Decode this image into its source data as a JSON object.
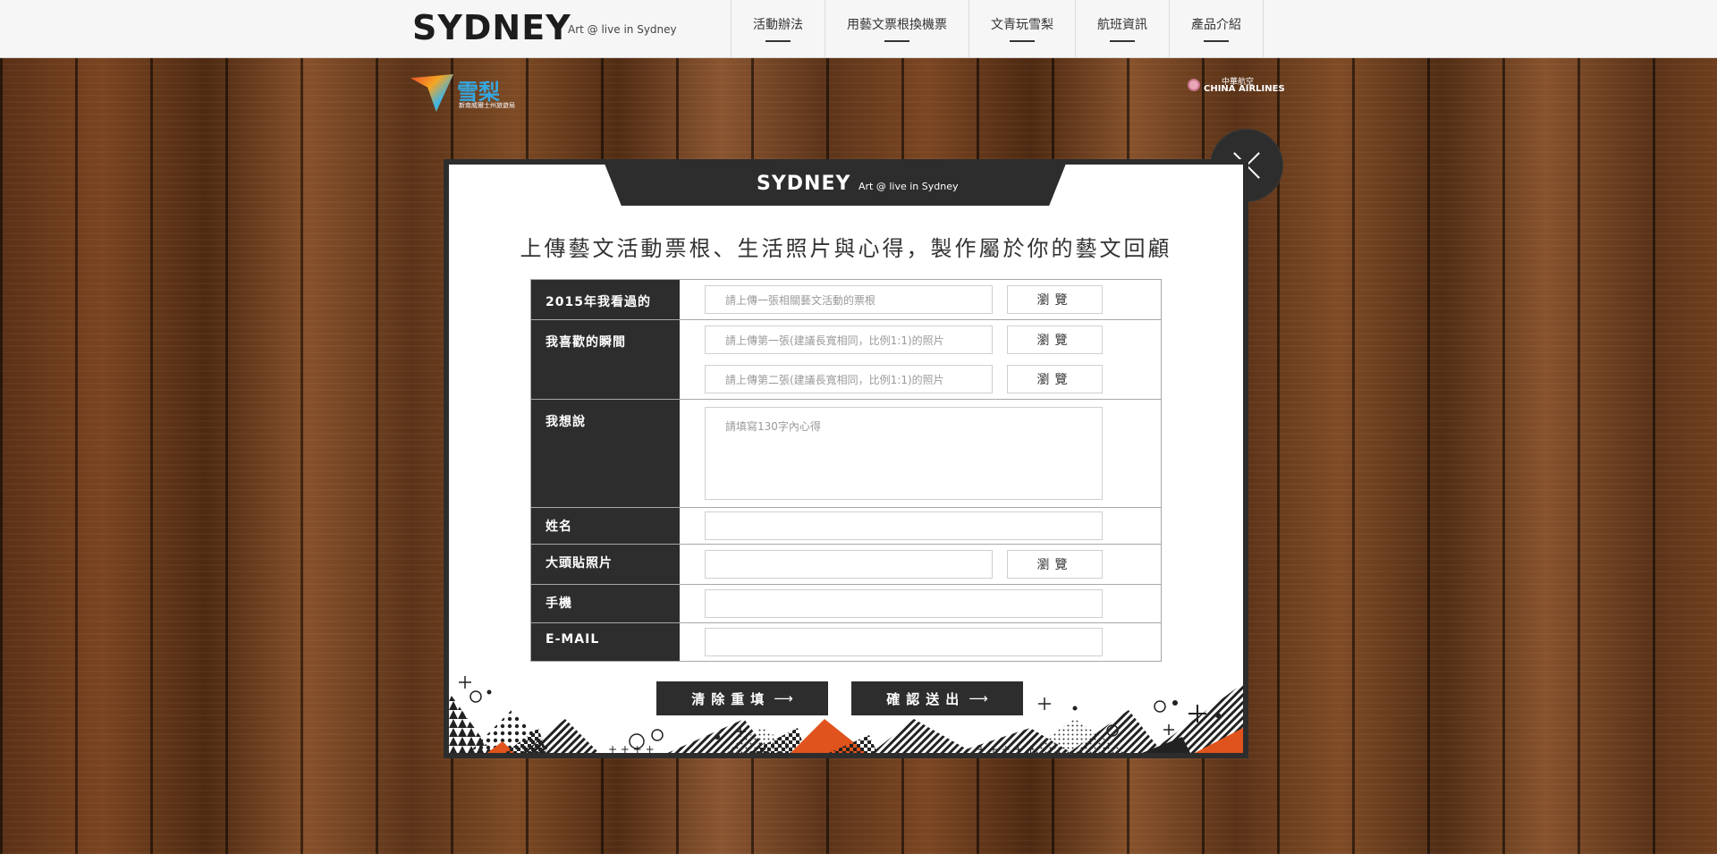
{
  "header": {
    "logo_text": "SYDNEY",
    "tagline": "Art @ live in Sydney",
    "nav": [
      {
        "label": "活動辦法"
      },
      {
        "label": "用藝文票根換機票"
      },
      {
        "label": "文青玩雪梨"
      },
      {
        "label": "航班資訊"
      },
      {
        "label": "產品介紹"
      }
    ]
  },
  "partners": {
    "left_brand": "雪梨",
    "left_sub": "新南威爾士州旅遊局",
    "right_cn": "中華航空",
    "right_en": "CHINA AIRLINES"
  },
  "modal": {
    "logo_text": "SYDNEY",
    "tagline": "Art @ live in Sydney",
    "title": "上傳藝文活動票根、生活照片與心得，製作屬於你的藝文回顧",
    "fields": {
      "ticket": {
        "label": "2015年我看過的",
        "placeholder": "請上傳一張相關藝文活動的票根",
        "browse_label": "瀏覽"
      },
      "moment": {
        "label": "我喜歡的瞬間",
        "placeholder_1": "請上傳第一張(建議長寬相同，比例1:1)的照片",
        "placeholder_2": "請上傳第二張(建議長寬相同，比例1:1)的照片",
        "browse_label_1": "瀏覽",
        "browse_label_2": "瀏覽"
      },
      "thoughts": {
        "label": "我想說",
        "placeholder": "請填寫130字內心得"
      },
      "name": {
        "label": "姓名",
        "value": ""
      },
      "avatar": {
        "label": "大頭貼照片",
        "value": "",
        "browse_label": "瀏覽"
      },
      "phone": {
        "label": "手機",
        "value": ""
      },
      "email": {
        "label": "E-MAIL",
        "value": ""
      }
    },
    "buttons": {
      "reset": "清除重填",
      "submit": "確認送出",
      "arrow": "⟶"
    }
  },
  "colors": {
    "dark": "#2d2d2d",
    "accent_orange": "#e0531c",
    "header_bg": "#f6f6f6"
  }
}
